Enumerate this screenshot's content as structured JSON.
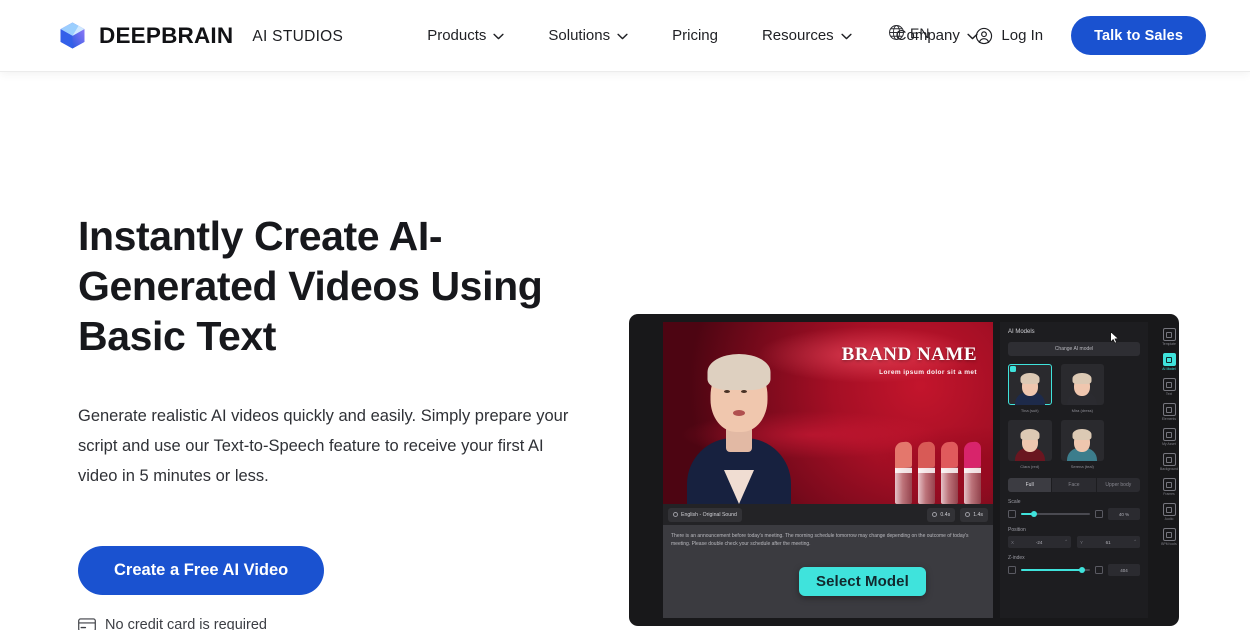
{
  "header": {
    "brand": {
      "name": "DEEPBRAIN",
      "suffix": "AI STUDIOS",
      "logo_icon": "cube-gem-icon"
    },
    "nav": [
      {
        "label": "Products",
        "has_dropdown": true
      },
      {
        "label": "Solutions",
        "has_dropdown": true
      },
      {
        "label": "Pricing",
        "has_dropdown": false
      },
      {
        "label": "Resources",
        "has_dropdown": true
      },
      {
        "label": "Company",
        "has_dropdown": true
      }
    ],
    "language": {
      "label": "EN",
      "icon": "globe-icon"
    },
    "login": {
      "label": "Log In",
      "icon": "user-circle-icon"
    },
    "cta": {
      "label": "Talk to Sales"
    },
    "colors": {
      "accent_blue": "#1a52d0",
      "text": "#1f2024"
    }
  },
  "hero": {
    "title": "Instantly Create AI-\nGenerated Videos Using\nBasic Text",
    "subtitle": "Generate realistic AI videos quickly and easily. Simply prepare your script and use our Text-to-Speech feature to receive your first AI video in 5 minutes or less.",
    "cta_label": "Create a Free AI Video",
    "note": "No credit card is required",
    "note_icon": "credit-card-icon"
  },
  "preview": {
    "video": {
      "brand_name": "BRAND NAME",
      "brand_tagline": "Lorem ipsum dolor sit a met"
    },
    "toolbar": {
      "voice_pill": "English - Original Sound",
      "duration_pill": "0.4s",
      "time_pill": "1.4s"
    },
    "script": "There is an announcement before today's meeting. The morning schedule tomorrow may change depending on the outcome of today's meeting. Please double check your schedule after the meeting.",
    "select_model_button": "Select Model",
    "panel": {
      "title": "AI Models",
      "change_button": "Change AI model",
      "models": [
        {
          "name": "Tina (suit)",
          "selected": true,
          "body_color": "#1d2a4a"
        },
        {
          "name": "Mira (dress)",
          "selected": false,
          "body_color": "#2b2b30"
        },
        {
          "name": "Clara (red)",
          "selected": false,
          "body_color": "#6a1620"
        },
        {
          "name": "Serena (teal)",
          "selected": false,
          "body_color": "#3c7d8c"
        }
      ],
      "tabs": [
        {
          "label": "Full",
          "active": true
        },
        {
          "label": "Face",
          "active": false
        },
        {
          "label": "Upper body",
          "active": false
        }
      ],
      "controls": [
        {
          "label": "Scale",
          "value": "40 %",
          "fill_percent": 16
        },
        {
          "label": "Position",
          "x_value": "-24",
          "y_value": "61"
        },
        {
          "label": "Z-index",
          "value": "404",
          "fill_percent": 88
        }
      ]
    },
    "rail": [
      {
        "label": "Template",
        "icon": "template-icon",
        "active": false
      },
      {
        "label": "AI Model",
        "icon": "ai-model-icon",
        "active": true
      },
      {
        "label": "Text",
        "icon": "text-icon",
        "active": false
      },
      {
        "label": "Elements",
        "icon": "elements-icon",
        "active": false
      },
      {
        "label": "My Asset",
        "icon": "my-asset-icon",
        "active": false
      },
      {
        "label": "Background",
        "icon": "background-icon",
        "active": false
      },
      {
        "label": "Frames",
        "icon": "frames-icon",
        "active": false
      },
      {
        "label": "Audio",
        "icon": "audio-icon",
        "active": false
      },
      {
        "label": "BPM tools",
        "icon": "bpm-tools-icon",
        "active": false
      }
    ],
    "cursor_icon": "mouse-pointer-icon",
    "accent_color": "#3fe3dc"
  }
}
